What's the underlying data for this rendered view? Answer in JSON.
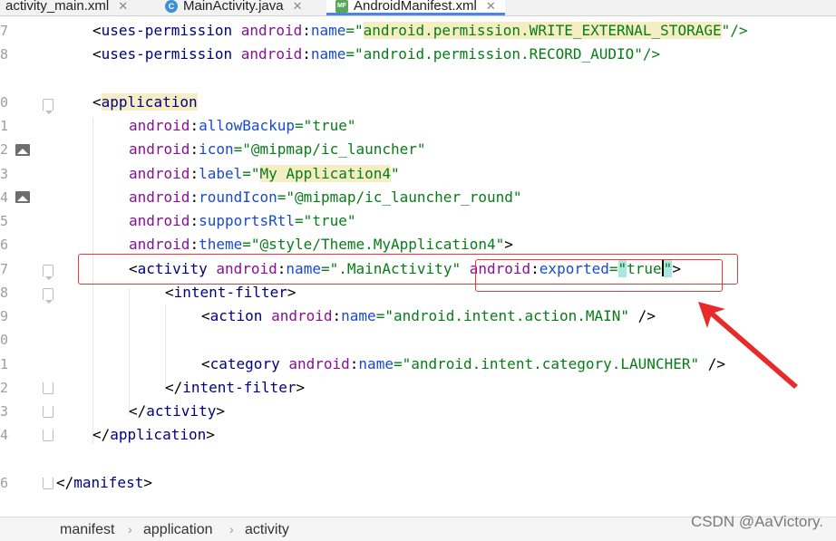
{
  "tabs": [
    {
      "label": "activity_main.xml",
      "icon": "xml-file-icon"
    },
    {
      "label": "MainActivity.java",
      "icon": "java-class-icon"
    },
    {
      "label": "AndroidManifest.xml",
      "icon": "manifest-file-icon",
      "active": true
    }
  ],
  "line_numbers": [
    "7",
    "8",
    "0",
    "1",
    "2",
    "3",
    "4",
    "5",
    "6",
    "7",
    "8",
    "9",
    "0",
    "1",
    "2",
    "3",
    "4",
    "6"
  ],
  "code": {
    "l0": {
      "open": "<",
      "tag": "uses-permission",
      "ns": "android",
      "colon": ":",
      "attr": "name",
      "eq": "=\"",
      "val": "android.permission.WRITE_EXTERNAL_STORAGE",
      "close": "\"/>"
    },
    "l1": {
      "open": "<",
      "tag": "uses-permission",
      "ns": "android",
      "colon": ":",
      "attr": "name",
      "eq": "=\"",
      "val": "android.permission.RECORD_AUDIO",
      "close": "\"/>"
    },
    "l2": {
      "open": "<",
      "tag": "application"
    },
    "l3": {
      "ns": "android",
      "colon": ":",
      "attr": "allowBackup",
      "val": "=\"true\""
    },
    "l4": {
      "ns": "android",
      "colon": ":",
      "attr": "icon",
      "val": "=\"@mipmap/ic_launcher\""
    },
    "l5": {
      "ns": "android",
      "colon": ":",
      "attr": "label",
      "eq": "=\"",
      "val": "My Application4",
      "close": "\""
    },
    "l6": {
      "ns": "android",
      "colon": ":",
      "attr": "roundIcon",
      "val": "=\"@mipmap/ic_launcher_round\""
    },
    "l7": {
      "ns": "android",
      "colon": ":",
      "attr": "supportsRtl",
      "val": "=\"true\""
    },
    "l8": {
      "ns": "android",
      "colon": ":",
      "attr": "theme",
      "val": "=\"@style/Theme.MyApplication4\"",
      "close": ">"
    },
    "l9": {
      "open": "<",
      "tag": "activity",
      "ns": "android",
      "colon": ":",
      "attr": "name",
      "val": "=\".MainActivity\"",
      "ns2": "android",
      "colon2": ":",
      "attr2": "exported",
      "eq2": "=",
      "q1": "\"",
      "val2": "true",
      "q2": "\"",
      "close": ">"
    },
    "l10": {
      "open": "<",
      "tag": "intent-filter",
      "close": ">"
    },
    "l11": {
      "open": "<",
      "tag": "action",
      "ns": "android",
      "colon": ":",
      "attr": "name",
      "val": "=\"android.intent.action.MAIN\"",
      "close": " />"
    },
    "l13": {
      "open": "<",
      "tag": "category",
      "ns": "android",
      "colon": ":",
      "attr": "name",
      "val": "=\"android.intent.category.LAUNCHER\"",
      "close": " />"
    },
    "l14": {
      "open": "</",
      "tag": "intent-filter",
      "close": ">"
    },
    "l15": {
      "open": "</",
      "tag": "activity",
      "close": ">"
    },
    "l16": {
      "open": "</",
      "tag": "application",
      "close": ">"
    },
    "l17": {
      "open": "</",
      "tag": "manifest",
      "close": ">"
    }
  },
  "breadcrumb": [
    "manifest",
    "application",
    "activity"
  ],
  "watermark": "CSDN @AaVictory.",
  "colors": {
    "annotation": "#e23b3b",
    "tag": "#000080",
    "namespace": "#871094",
    "attribute": "#174ad4",
    "value": "#067d17"
  }
}
